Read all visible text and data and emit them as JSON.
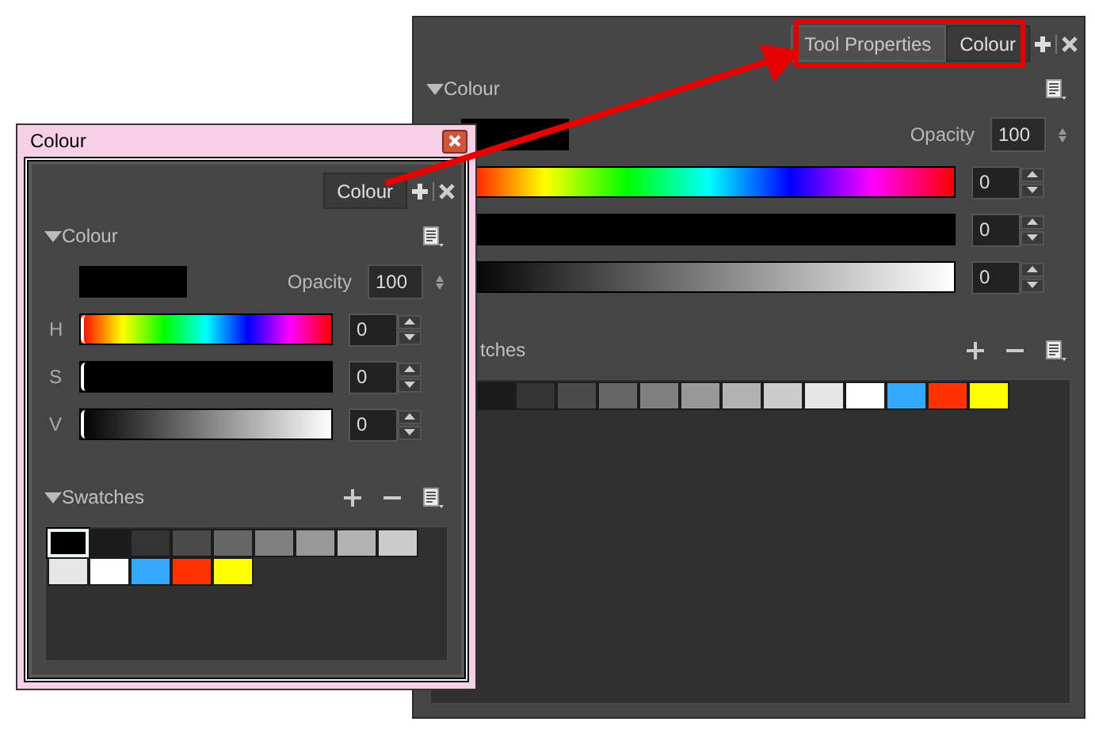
{
  "docked_panel": {
    "tabs": [
      {
        "label": "Tool Properties",
        "selected": false
      },
      {
        "label": "Colour",
        "selected": true
      }
    ],
    "colour_section": {
      "title": "Colour",
      "opacity_label": "Opacity",
      "opacity_value": "100",
      "sliders": [
        {
          "kind": "hue",
          "level": 0,
          "value": "0"
        },
        {
          "kind": "saturation",
          "level": 0,
          "value": "0"
        },
        {
          "kind": "value",
          "level": 0,
          "value": "0"
        }
      ]
    },
    "swatches_section": {
      "title": "tches",
      "swatches": [
        {
          "color": "#1a1a1a"
        },
        {
          "color": "#333333"
        },
        {
          "color": "#4a4a4a"
        },
        {
          "color": "#666666"
        },
        {
          "color": "#808080"
        },
        {
          "color": "#999999"
        },
        {
          "color": "#b3b3b3"
        },
        {
          "color": "#cccccc"
        },
        {
          "color": "#e6e6e6"
        },
        {
          "color": "#ffffff"
        },
        {
          "color": "#33aaff"
        },
        {
          "color": "#ff3300"
        },
        {
          "color": "#ffff00"
        }
      ]
    }
  },
  "floating_window": {
    "title": "Colour",
    "tabs": [
      {
        "label": "Colour",
        "selected": true
      }
    ],
    "colour_section": {
      "title": "Colour",
      "opacity_label": "Opacity",
      "opacity_value": "100",
      "sliders": [
        {
          "kind": "hue",
          "label": "H",
          "level": 0,
          "value": "0"
        },
        {
          "kind": "saturation",
          "label": "S",
          "level": 0,
          "value": "0"
        },
        {
          "kind": "value",
          "label": "V",
          "level": 0,
          "value": "0"
        }
      ]
    },
    "swatches_section": {
      "title": "Swatches",
      "swatches": [
        {
          "color": "#000000",
          "selected": true
        },
        {
          "color": "#1a1a1a",
          "selected": false
        },
        {
          "color": "#333333",
          "selected": false
        },
        {
          "color": "#4a4a4a",
          "selected": false
        },
        {
          "color": "#666666",
          "selected": false
        },
        {
          "color": "#808080",
          "selected": false
        },
        {
          "color": "#999999",
          "selected": false
        },
        {
          "color": "#b3b3b3",
          "selected": false
        },
        {
          "color": "#cccccc",
          "selected": false
        },
        {
          "color": "#e6e6e6",
          "selected": false
        },
        {
          "color": "#ffffff",
          "selected": false
        },
        {
          "color": "#33aaff",
          "selected": false
        },
        {
          "color": "#ff3300",
          "selected": false
        },
        {
          "color": "#ffff00",
          "selected": false
        }
      ]
    }
  }
}
